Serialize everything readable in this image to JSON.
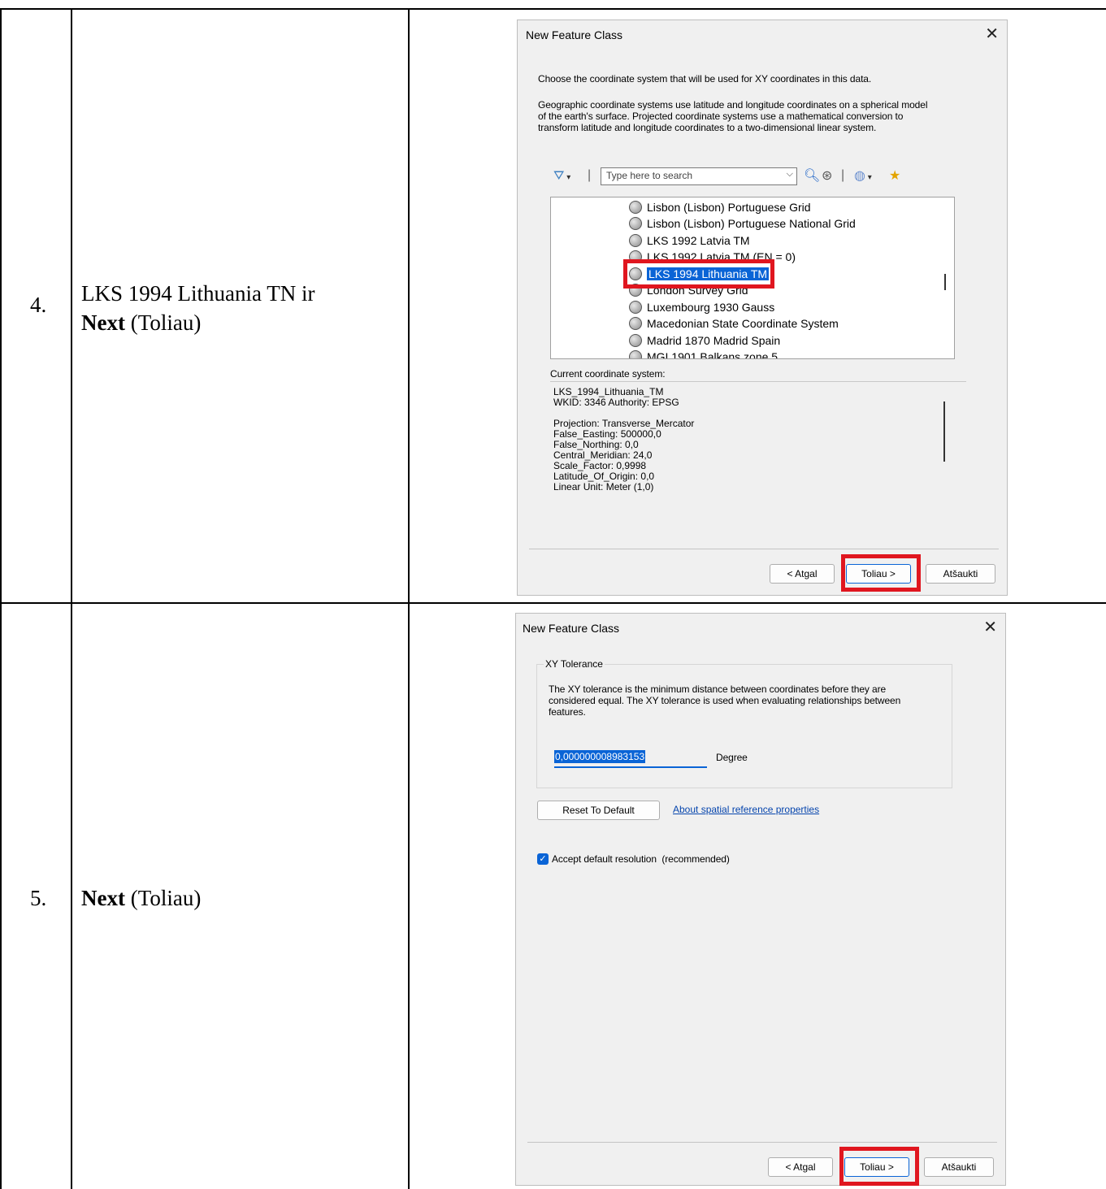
{
  "steps": [
    {
      "number": "4.",
      "text_plain": "LKS 1994 Lithuania TN ir",
      "text_bold": "Next",
      "text_after": "(Toliau)"
    },
    {
      "number": "5.",
      "text_bold": "Next",
      "text_after": "(Toliau)"
    }
  ],
  "dialog1": {
    "title": "New Feature Class",
    "intro": "Choose the coordinate system that will be used for XY coordinates in this data.",
    "desc1": "Geographic coordinate systems use latitude and longitude coordinates on a spherical model",
    "desc2": "of the earth's surface. Projected coordinate systems use a mathematical conversion to",
    "desc3": "transform latitude and longitude coordinates to a two-dimensional linear system.",
    "search_placeholder": "Type here to search",
    "list_items": [
      "Lisbon (Lisbon) Portuguese Grid",
      "Lisbon (Lisbon) Portuguese National Grid",
      "LKS 1992 Latvia TM",
      "LKS 1992 Latvia TM (EN = 0)",
      "LKS 1994 Lithuania TM",
      "London Survey Grid",
      "Luxembourg 1930 Gauss",
      "Macedonian State Coordinate System",
      "Madrid 1870 Madrid Spain",
      "MGI 1901 Balkans zone 5"
    ],
    "selected_item": "LKS 1994 Lithuania TM",
    "current_label": "Current coordinate system:",
    "info_lines": [
      "LKS_1994_Lithuania_TM",
      "WKID: 3346 Authority: EPSG",
      "",
      "Projection: Transverse_Mercator",
      "False_Easting: 500000,0",
      "False_Northing: 0,0",
      "Central_Meridian: 24,0",
      "Scale_Factor: 0,9998",
      "Latitude_Of_Origin: 0,0",
      "Linear Unit: Meter (1,0)"
    ],
    "back_label": "< Atgal",
    "next_label": "Toliau >",
    "cancel_label": "Atšaukti"
  },
  "dialog2": {
    "title": "New Feature Class",
    "group_title": "XY Tolerance",
    "desc1": "The XY tolerance is the minimum distance between coordinates before they are",
    "desc2": "considered equal. The XY tolerance is used when evaluating relationships between",
    "desc3": "features.",
    "tolerance_value": "0,000000008983153",
    "unit": "Degree",
    "reset_label": "Reset To Default",
    "link_label": "About spatial reference properties",
    "checkbox_label": "Accept default resolution  (recommended)",
    "checkbox_checked": true,
    "back_label": "< Atgal",
    "next_label": "Toliau >",
    "cancel_label": "Atšaukti"
  },
  "colors": {
    "highlight": "#e0161f",
    "selection": "#0a64d6"
  }
}
